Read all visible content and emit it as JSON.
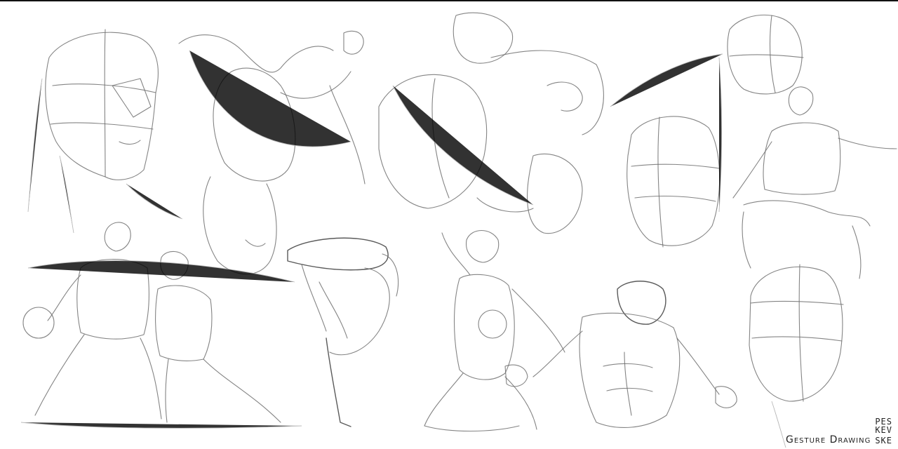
{
  "signature": {
    "line1": "PES",
    "line2": "KEV",
    "line3": "SKE",
    "title": "Gesture Drawing"
  },
  "colors": {
    "background": "#ffffff",
    "top_bar": "#111111",
    "sketch_stroke": "#6f6f6f",
    "signature_ink": "#222222"
  }
}
